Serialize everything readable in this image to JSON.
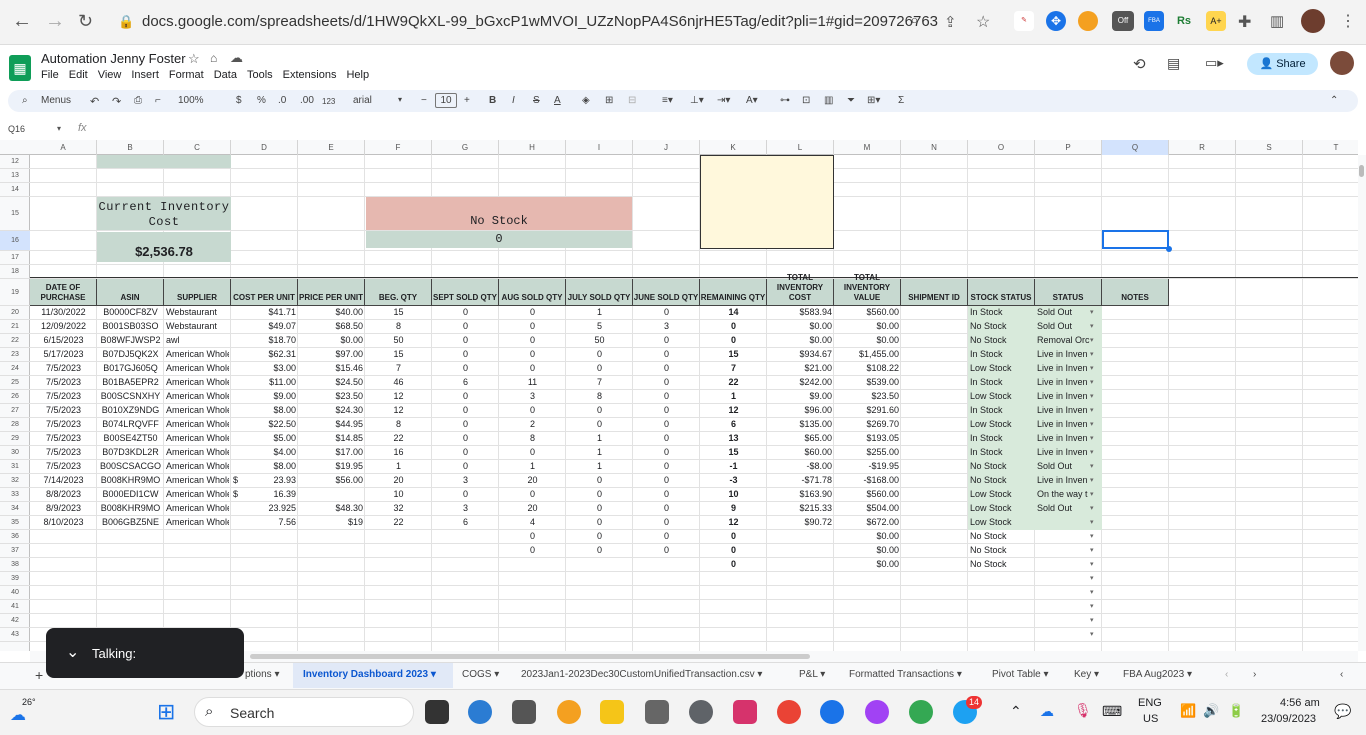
{
  "browser": {
    "url": "docs.google.com/spreadsheets/d/1HW9QkXL-99_bGxcP1wMVOI_UZzNopPA4S6njrHE5Tag/edit?pli=1#gid=209726763",
    "off_badge": "Off",
    "fba_badge": "FBA",
    "rs_badge": "Rs"
  },
  "doc": {
    "title": "Automation Jenny Foster",
    "share": "Share"
  },
  "menu": [
    "File",
    "Edit",
    "View",
    "Insert",
    "Format",
    "Data",
    "Tools",
    "Extensions",
    "Help"
  ],
  "toolbar": {
    "menus": "Menus",
    "zoom": "100%",
    "currency": "$",
    "percent": "%",
    "dec_less": ".0",
    "dec_more": ".00",
    "number": "123",
    "font": "arial",
    "font_size": "10",
    "minus": "−",
    "plus": "+",
    "bold": "B",
    "italic": "I",
    "strike": "S",
    "underline": "A",
    "sigma": "Σ"
  },
  "formula": {
    "namebox": "Q16",
    "fx": "fx"
  },
  "columns": [
    "A",
    "B",
    "C",
    "D",
    "E",
    "F",
    "G",
    "H",
    "I",
    "J",
    "K",
    "L",
    "M",
    "N",
    "O",
    "P",
    "Q",
    "R",
    "S",
    "T"
  ],
  "rows": [
    "12",
    "13",
    "14",
    "15",
    "16",
    "17",
    "18",
    "19",
    "20",
    "21",
    "22",
    "23",
    "24",
    "25",
    "26",
    "27",
    "28",
    "29",
    "30",
    "31",
    "32",
    "33",
    "34",
    "35",
    "36",
    "37",
    "38",
    "39",
    "40",
    "41",
    "42",
    "43"
  ],
  "summary": {
    "inventory_label": "Current Inventory Cost",
    "inventory_value": "$2,536.78",
    "nostock_label": "No Stock",
    "nostock_value": "0"
  },
  "headers": [
    "DATE OF PURCHASE",
    "ASIN",
    "SUPPLIER",
    "COST PER UNIT",
    "PRICE PER UNIT",
    "BEG. QTY",
    "SEPT SOLD QTY",
    "AUG SOLD QTY",
    "JULY SOLD QTY",
    "JUNE SOLD QTY",
    "REMAINING QTY",
    "TOTAL INVENTORY COST",
    "TOTAL INVENTORY VALUE",
    "SHIPMENT ID",
    "STOCK STATUS",
    "STATUS",
    "NOTES"
  ],
  "table": [
    [
      "11/30/2022",
      "B0000CF8ZV",
      "Webstaurant",
      "",
      "$41.71",
      "$40.00",
      "15",
      "0",
      "0",
      "1",
      "0",
      "14",
      "$583.94",
      "$560.00",
      "",
      "In Stock",
      "Sold Out"
    ],
    [
      "12/09/2022",
      "B001SB03SO",
      "Webstaurant",
      "",
      "$49.07",
      "$68.50",
      "8",
      "0",
      "0",
      "5",
      "3",
      "0",
      "$0.00",
      "$0.00",
      "",
      "No Stock",
      "Sold Out"
    ],
    [
      "6/15/2023",
      "B08WFJWSP2",
      "awl",
      "",
      "$18.70",
      "$0.00",
      "50",
      "0",
      "0",
      "50",
      "0",
      "0",
      "$0.00",
      "$0.00",
      "",
      "No Stock",
      "Removal Orc"
    ],
    [
      "5/17/2023",
      "B07DJ5QK2X",
      "American Whole",
      "",
      "$62.31",
      "$97.00",
      "15",
      "0",
      "0",
      "0",
      "0",
      "15",
      "$934.67",
      "$1,455.00",
      "",
      "In Stock",
      "Live in Inven"
    ],
    [
      "7/5/2023",
      "B017GJ605Q",
      "American Whole",
      "",
      "$3.00",
      "$15.46",
      "7",
      "0",
      "0",
      "0",
      "0",
      "7",
      "$21.00",
      "$108.22",
      "",
      "Low Stock",
      "Live in Inven"
    ],
    [
      "7/5/2023",
      "B01BA5EPR2",
      "American Whole",
      "",
      "$11.00",
      "$24.50",
      "46",
      "6",
      "11",
      "7",
      "0",
      "22",
      "$242.00",
      "$539.00",
      "",
      "In Stock",
      "Live in Inven"
    ],
    [
      "7/5/2023",
      "B00SCSNXHY",
      "American Whole",
      "",
      "$9.00",
      "$23.50",
      "12",
      "0",
      "3",
      "8",
      "0",
      "1",
      "$9.00",
      "$23.50",
      "",
      "Low Stock",
      "Live in Inven"
    ],
    [
      "7/5/2023",
      "B010XZ9NDG",
      "American Whole",
      "",
      "$8.00",
      "$24.30",
      "12",
      "0",
      "0",
      "0",
      "0",
      "12",
      "$96.00",
      "$291.60",
      "",
      "In Stock",
      "Live in Inven"
    ],
    [
      "7/5/2023",
      "B074LRQVFF",
      "American Whole",
      "",
      "$22.50",
      "$44.95",
      "8",
      "0",
      "2",
      "0",
      "0",
      "6",
      "$135.00",
      "$269.70",
      "",
      "Low Stock",
      "Live in Inven"
    ],
    [
      "7/5/2023",
      "B00SE4ZT50",
      "American Whole",
      "",
      "$5.00",
      "$14.85",
      "22",
      "0",
      "8",
      "1",
      "0",
      "13",
      "$65.00",
      "$193.05",
      "",
      "In Stock",
      "Live in Inven"
    ],
    [
      "7/5/2023",
      "B07D3KDL2R",
      "American Whole",
      "",
      "$4.00",
      "$17.00",
      "16",
      "0",
      "0",
      "1",
      "0",
      "15",
      "$60.00",
      "$255.00",
      "",
      "In Stock",
      "Live in Inven"
    ],
    [
      "7/5/2023",
      "B00SCSACGO",
      "American Whole",
      "",
      "$8.00",
      "$19.95",
      "1",
      "0",
      "1",
      "1",
      "0",
      "-1",
      "-$8.00",
      "-$19.95",
      "",
      "No Stock",
      "Sold Out"
    ],
    [
      "7/14/2023",
      "B008KHR9MO",
      "American Whole",
      "$",
      "23.93",
      "$56.00",
      "20",
      "3",
      "20",
      "0",
      "0",
      "-3",
      "-$71.78",
      "-$168.00",
      "",
      "No Stock",
      "Live in Inven"
    ],
    [
      "8/8/2023",
      "B000EDI1CW",
      "American Whole",
      "$",
      "16.39",
      "",
      "10",
      "0",
      "0",
      "0",
      "0",
      "10",
      "$163.90",
      "$560.00",
      "",
      "Low Stock",
      "On the way t"
    ],
    [
      "8/9/2023",
      "B008KHR9MO",
      "American Whole",
      "",
      "23.925",
      "$48.30",
      "32",
      "3",
      "20",
      "0",
      "0",
      "9",
      "$215.33",
      "$504.00",
      "",
      "Low Stock",
      "Sold Out"
    ],
    [
      "8/10/2023",
      "B006GBZ5NE",
      "American Whole",
      "",
      "7.56",
      "$19",
      "22",
      "6",
      "4",
      "0",
      "0",
      "12",
      "$90.72",
      "$672.00",
      "",
      "Low Stock",
      ""
    ],
    [
      "",
      "",
      "",
      "",
      "",
      "",
      "",
      "",
      "0",
      "0",
      "0",
      "0",
      "",
      "$0.00",
      "",
      "No Stock",
      ""
    ],
    [
      "",
      "",
      "",
      "",
      "",
      "",
      "",
      "",
      "0",
      "0",
      "0",
      "0",
      "",
      "$0.00",
      "",
      "No Stock",
      ""
    ],
    [
      "",
      "",
      "",
      "",
      "",
      "",
      "",
      "",
      "",
      "",
      "",
      "0",
      "",
      "$0.00",
      "",
      "No Stock",
      ""
    ]
  ],
  "tabs": [
    "ptions",
    "Inventory Dashboard 2023",
    "COGS",
    "2023Jan1-2023Dec30CustomUnifiedTransaction.csv",
    "P&L",
    "Formatted Transactions",
    "Pivot Table",
    "Key",
    "FBA Aug2023"
  ],
  "toast": {
    "text": "Talking:"
  },
  "taskbar": {
    "weather": "26°",
    "search": "Search",
    "lang1": "ENG",
    "lang2": "US",
    "time": "4:56 am",
    "date": "23/09/2023",
    "badge": "14"
  }
}
